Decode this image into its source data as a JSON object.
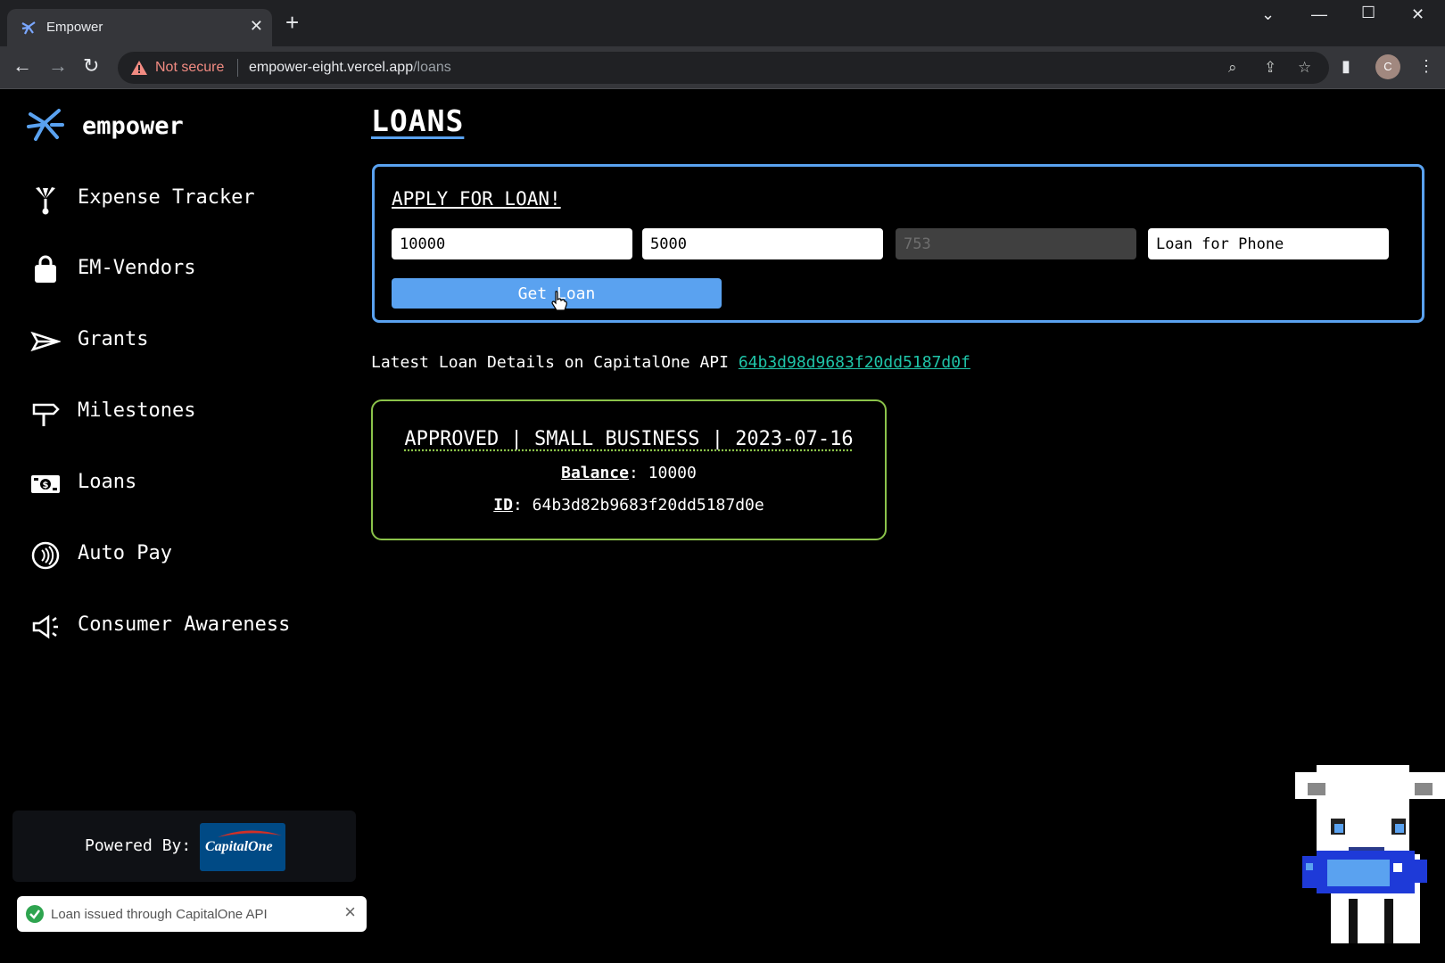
{
  "browser": {
    "tab_title": "Empower",
    "security_label": "Not secure",
    "url_host": "empower-eight.vercel.app",
    "url_path": "/loans",
    "profile_initial": "C"
  },
  "sidebar": {
    "brand": "empower",
    "items": [
      {
        "label": "Expense Tracker",
        "icon": "money-tree-icon"
      },
      {
        "label": "EM-Vendors",
        "icon": "shopping-bag-icon"
      },
      {
        "label": "Grants",
        "icon": "paper-plane-icon"
      },
      {
        "label": "Milestones",
        "icon": "signpost-icon"
      },
      {
        "label": "Loans",
        "icon": "banknote-icon"
      },
      {
        "label": "Auto Pay",
        "icon": "contactless-icon"
      },
      {
        "label": "Consumer Awareness",
        "icon": "megaphone-icon"
      }
    ],
    "powered_by": "Powered By:",
    "partner_logo_text": "CapitalOne"
  },
  "main": {
    "title": "LOANS",
    "apply": {
      "title": "APPLY FOR LOAN!",
      "fields": [
        {
          "value": "10000"
        },
        {
          "value": "5000"
        },
        {
          "value": "753",
          "disabled": true
        },
        {
          "value": "Loan for Phone"
        }
      ],
      "button_label": "Get Loan"
    },
    "latest": {
      "label": "Latest Loan Details on CapitalOne API",
      "link_text": "64b3d98d9683f20dd5187d0f"
    },
    "loan_card": {
      "header": "APPROVED | SMALL BUSINESS | 2023-07-16",
      "balance_label": "Balance",
      "balance_value": "10000",
      "id_label": "ID",
      "id_value": "64b3d82b9683f20dd5187d0e"
    }
  },
  "toast": {
    "message": "Loan issued through CapitalOne API",
    "status_color": "#2ea44f"
  },
  "colors": {
    "accent": "#5aa2f0",
    "card_border": "#8bc34a",
    "link": "#1fc4a8"
  }
}
